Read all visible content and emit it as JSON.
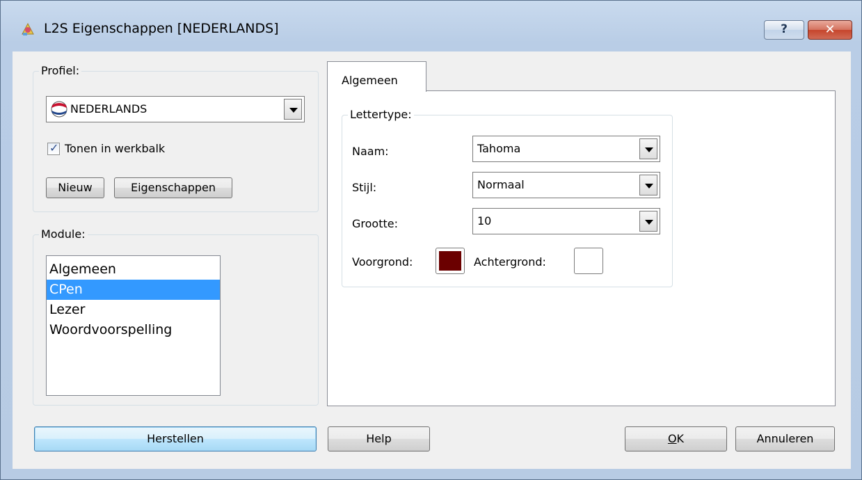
{
  "window": {
    "title": "L2S Eigenschappen [NEDERLANDS]",
    "help_button": "?",
    "close_button": "✕"
  },
  "profile_group": {
    "label": "Profiel:",
    "selected": "NEDERLANDS",
    "checkbox_label": "Tonen in werkbalk",
    "checkbox_checked": true,
    "new_button": "Nieuw",
    "properties_button": "Eigenschappen"
  },
  "module_group": {
    "label": "Module:",
    "items": [
      "Algemeen",
      "CPen",
      "Lezer",
      "Woordvoorspelling"
    ],
    "selected_index": 1
  },
  "tabs": [
    {
      "label": "Algemeen",
      "active": true
    }
  ],
  "font_group": {
    "label": "Lettertype:",
    "name_label": "Naam:",
    "name_value": "Tahoma",
    "style_label": "Stijl:",
    "style_value": "Normaal",
    "size_label": "Grootte:",
    "size_value": "10",
    "foreground_label": "Voorgrond:",
    "foreground_color": "#6b0000",
    "background_label": "Achtergrond:",
    "background_color": "#ffffff"
  },
  "footer": {
    "reset_button": "Herstellen",
    "help_button": "Help",
    "ok_button": "OK",
    "cancel_button": "Annuleren"
  }
}
